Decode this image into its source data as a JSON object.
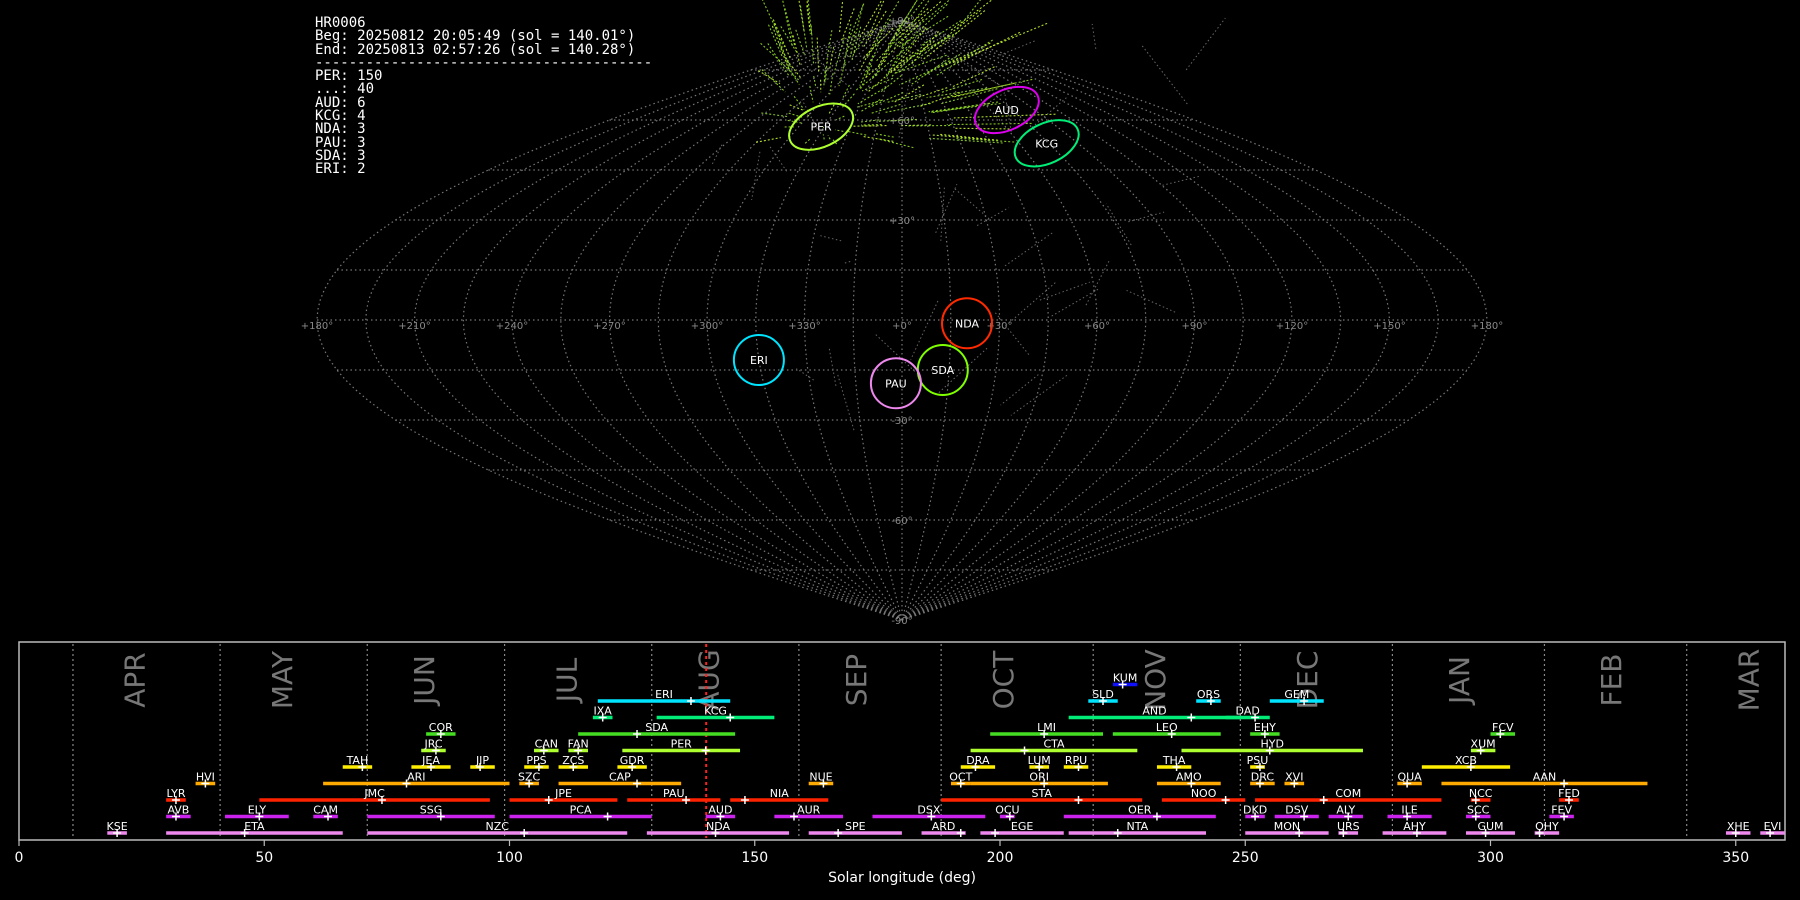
{
  "info": {
    "lines": [
      "HR0006",
      "Beg: 20250812 20:05:49 (sol = 140.01°)",
      "End: 20250813 02:57:26 (sol = 140.28°)",
      "----------------------------------------",
      "PER: 150",
      "...: 40",
      "AUD: 6",
      "KCG: 4",
      "NDA: 3",
      "PAU: 3",
      "SDA: 3",
      "ERI: 2"
    ]
  },
  "chart_data": [
    {
      "type": "scatter",
      "projection": "sinusoidal",
      "grid": true,
      "lon_tick_labels": [
        "+180°",
        "+150°",
        "+120°",
        "+90°",
        "+60°",
        "+30°",
        "+0°",
        "+330°",
        "+300°",
        "+270°",
        "+240°",
        "+210°",
        "+180°"
      ],
      "lat_tick_labels": [
        "+90°",
        "+60°",
        "+30°",
        "-30°",
        "-60°",
        "-90°"
      ],
      "radiants": [
        {
          "name": "PER",
          "lon": 47,
          "lat": 58,
          "color": "#adff2f"
        },
        {
          "name": "AUD",
          "lon": 289,
          "lat": 63,
          "color": "#dd00ee"
        },
        {
          "name": "KCG",
          "lon": 286,
          "lat": 53,
          "color": "#00ee77"
        },
        {
          "name": "NDA",
          "lon": 340,
          "lat": -1,
          "color": "#ff2a00"
        },
        {
          "name": "SDA",
          "lon": 347,
          "lat": -15,
          "color": "#7fff00"
        },
        {
          "name": "PAU",
          "lon": 2,
          "lat": -19,
          "color": "#ee88ee"
        },
        {
          "name": "ERI",
          "lon": 45,
          "lat": -12,
          "color": "#00e5ff"
        }
      ]
    },
    {
      "type": "bar",
      "orientation": "horizontal",
      "xlabel": "Solar longitude (deg)",
      "xlim": [
        0,
        360
      ],
      "x_ticks": [
        0,
        50,
        100,
        150,
        200,
        250,
        300,
        350
      ],
      "current_sol": 140.1,
      "months": [
        {
          "label": "APR",
          "pos": 24
        },
        {
          "label": "MAY",
          "pos": 54
        },
        {
          "label": "JUN",
          "pos": 83
        },
        {
          "label": "JUL",
          "pos": 112
        },
        {
          "label": "AUG",
          "pos": 141
        },
        {
          "label": "SEP",
          "pos": 171
        },
        {
          "label": "OCT",
          "pos": 201
        },
        {
          "label": "NOV",
          "pos": 232
        },
        {
          "label": "DEC",
          "pos": 263
        },
        {
          "label": "JAN",
          "pos": 294
        },
        {
          "label": "FEB",
          "pos": 325
        },
        {
          "label": "MAR",
          "pos": 353
        }
      ],
      "month_boundaries": [
        11,
        41,
        71,
        99,
        129,
        159,
        188,
        219,
        249,
        280,
        311,
        340
      ],
      "showers": [
        {
          "code": "KUM",
          "start": 223,
          "end": 228,
          "peak": 225,
          "row": 9,
          "color": "#1010ff"
        },
        {
          "code": "ERI",
          "start": 118,
          "end": 145,
          "peak": 137,
          "row": 8,
          "color": "#00e5ff"
        },
        {
          "code": "SLD",
          "start": 218,
          "end": 224,
          "peak": 221,
          "row": 8,
          "color": "#00e5ff"
        },
        {
          "code": "ORS",
          "start": 240,
          "end": 245,
          "peak": 243,
          "row": 8,
          "color": "#00e5ff"
        },
        {
          "code": "GEM",
          "start": 255,
          "end": 266,
          "peak": 262,
          "row": 8,
          "color": "#00e5ff"
        },
        {
          "code": "IXA",
          "start": 117,
          "end": 121,
          "peak": 119,
          "row": 7,
          "color": "#00ee77"
        },
        {
          "code": "KCG",
          "start": 130,
          "end": 154,
          "peak": 145,
          "row": 7,
          "color": "#00ee77"
        },
        {
          "code": "AND",
          "start": 214,
          "end": 249,
          "peak": 239,
          "row": 7,
          "color": "#00ee77"
        },
        {
          "code": "DAD",
          "start": 246,
          "end": 255,
          "peak": 252,
          "row": 7,
          "color": "#00ee77"
        },
        {
          "code": "COR",
          "start": 83,
          "end": 89,
          "peak": 86,
          "row": 6,
          "color": "#44dd22"
        },
        {
          "code": "SDA",
          "start": 114,
          "end": 146,
          "peak": 126,
          "row": 6,
          "color": "#44dd22"
        },
        {
          "code": "LMI",
          "start": 198,
          "end": 221,
          "peak": 209,
          "row": 6,
          "color": "#44dd22"
        },
        {
          "code": "LEO",
          "start": 223,
          "end": 245,
          "peak": 235,
          "row": 6,
          "color": "#44dd22"
        },
        {
          "code": "EHY",
          "start": 251,
          "end": 257,
          "peak": 254,
          "row": 6,
          "color": "#44dd22"
        },
        {
          "code": "FCV",
          "start": 300,
          "end": 305,
          "peak": 302,
          "row": 6,
          "color": "#44dd22"
        },
        {
          "code": "JRC",
          "start": 82,
          "end": 87,
          "peak": 85,
          "row": 5,
          "color": "#adff2f"
        },
        {
          "code": "CAN",
          "start": 105,
          "end": 110,
          "peak": 107,
          "row": 5,
          "color": "#adff2f"
        },
        {
          "code": "FAN",
          "start": 112,
          "end": 116,
          "peak": 114,
          "row": 5,
          "color": "#adff2f"
        },
        {
          "code": "PER",
          "start": 123,
          "end": 147,
          "peak": 140,
          "row": 5,
          "color": "#adff2f"
        },
        {
          "code": "CTA",
          "start": 194,
          "end": 228,
          "peak": 205,
          "row": 5,
          "color": "#adff2f"
        },
        {
          "code": "HYD",
          "start": 237,
          "end": 274,
          "peak": 255,
          "row": 5,
          "color": "#adff2f"
        },
        {
          "code": "XUM",
          "start": 296,
          "end": 301,
          "peak": 298,
          "row": 5,
          "color": "#adff2f"
        },
        {
          "code": "TAH",
          "start": 66,
          "end": 72,
          "peak": 70,
          "row": 4,
          "color": "#ffee00"
        },
        {
          "code": "JEA",
          "start": 80,
          "end": 88,
          "peak": 84,
          "row": 4,
          "color": "#ffee00"
        },
        {
          "code": "JIP",
          "start": 92,
          "end": 97,
          "peak": 94,
          "row": 4,
          "color": "#ffee00"
        },
        {
          "code": "PPS",
          "start": 103,
          "end": 108,
          "peak": 106,
          "row": 4,
          "color": "#ffee00"
        },
        {
          "code": "ZCS",
          "start": 110,
          "end": 116,
          "peak": 113,
          "row": 4,
          "color": "#ffee00"
        },
        {
          "code": "GDR",
          "start": 122,
          "end": 128,
          "peak": 125,
          "row": 4,
          "color": "#ffee00"
        },
        {
          "code": "DRA",
          "start": 192,
          "end": 199,
          "peak": 195,
          "row": 4,
          "color": "#ffee00"
        },
        {
          "code": "LUM",
          "start": 206,
          "end": 210,
          "peak": 208,
          "row": 4,
          "color": "#ffee00"
        },
        {
          "code": "RPU",
          "start": 213,
          "end": 218,
          "peak": 216,
          "row": 4,
          "color": "#ffee00"
        },
        {
          "code": "THA",
          "start": 232,
          "end": 239,
          "peak": 236,
          "row": 4,
          "color": "#ffee00"
        },
        {
          "code": "PSU",
          "start": 251,
          "end": 254,
          "peak": 253,
          "row": 4,
          "color": "#ffee00"
        },
        {
          "code": "XCB",
          "start": 286,
          "end": 304,
          "peak": 296,
          "row": 4,
          "color": "#ffee00"
        },
        {
          "code": "HVI",
          "start": 36,
          "end": 40,
          "peak": 38,
          "row": 3,
          "color": "#ffaa00"
        },
        {
          "code": "ARI",
          "start": 62,
          "end": 100,
          "peak": 79,
          "row": 3,
          "color": "#ffaa00"
        },
        {
          "code": "SZC",
          "start": 102,
          "end": 106,
          "peak": 104,
          "row": 3,
          "color": "#ffaa00"
        },
        {
          "code": "CAP",
          "start": 110,
          "end": 135,
          "peak": 126,
          "row": 3,
          "color": "#ffaa00"
        },
        {
          "code": "NUE",
          "start": 161,
          "end": 166,
          "peak": 164,
          "row": 3,
          "color": "#ffaa00"
        },
        {
          "code": "OCT",
          "start": 190,
          "end": 194,
          "peak": 192,
          "row": 3,
          "color": "#ffaa00"
        },
        {
          "code": "ORI",
          "start": 194,
          "end": 222,
          "peak": 209,
          "row": 3,
          "color": "#ffaa00"
        },
        {
          "code": "AMO",
          "start": 232,
          "end": 245,
          "peak": 239,
          "row": 3,
          "color": "#ffaa00"
        },
        {
          "code": "DRC",
          "start": 251,
          "end": 256,
          "peak": 253,
          "row": 3,
          "color": "#ffaa00"
        },
        {
          "code": "XVI",
          "start": 258,
          "end": 262,
          "peak": 260,
          "row": 3,
          "color": "#ffaa00"
        },
        {
          "code": "QUA",
          "start": 281,
          "end": 286,
          "peak": 283,
          "row": 3,
          "color": "#ffaa00"
        },
        {
          "code": "AAN",
          "start": 290,
          "end": 332,
          "peak": 315,
          "row": 3,
          "color": "#ffaa00"
        },
        {
          "code": "LYR",
          "start": 30,
          "end": 34,
          "peak": 32,
          "row": 2,
          "color": "#ff2200"
        },
        {
          "code": "JMC",
          "start": 49,
          "end": 96,
          "peak": 74,
          "row": 2,
          "color": "#ff2200"
        },
        {
          "code": "JPE",
          "start": 100,
          "end": 122,
          "peak": 108,
          "row": 2,
          "color": "#ff2200"
        },
        {
          "code": "PAU",
          "start": 124,
          "end": 143,
          "peak": 136,
          "row": 2,
          "color": "#ff2200"
        },
        {
          "code": "NIA",
          "start": 145,
          "end": 165,
          "peak": 148,
          "row": 2,
          "color": "#ff2200"
        },
        {
          "code": "STA",
          "start": 188,
          "end": 229,
          "peak": 216,
          "row": 2,
          "color": "#ff2200"
        },
        {
          "code": "NOO",
          "start": 233,
          "end": 250,
          "peak": 246,
          "row": 2,
          "color": "#ff2200"
        },
        {
          "code": "COM",
          "start": 252,
          "end": 290,
          "peak": 266,
          "row": 2,
          "color": "#ff2200"
        },
        {
          "code": "NCC",
          "start": 296,
          "end": 300,
          "peak": 297,
          "row": 2,
          "color": "#ff2200"
        },
        {
          "code": "FED",
          "start": 314,
          "end": 318,
          "peak": 316,
          "row": 2,
          "color": "#ff2200"
        },
        {
          "code": "AVB",
          "start": 30,
          "end": 35,
          "peak": 32,
          "row": 1,
          "color": "#cc22ee"
        },
        {
          "code": "ELY",
          "start": 42,
          "end": 55,
          "peak": 49,
          "row": 1,
          "color": "#cc22ee"
        },
        {
          "code": "CAM",
          "start": 60,
          "end": 65,
          "peak": 63,
          "row": 1,
          "color": "#cc22ee"
        },
        {
          "code": "SSG",
          "start": 71,
          "end": 97,
          "peak": 86,
          "row": 1,
          "color": "#cc22ee"
        },
        {
          "code": "PCA",
          "start": 100,
          "end": 129,
          "peak": 120,
          "row": 1,
          "color": "#cc22ee"
        },
        {
          "code": "AUD",
          "start": 140,
          "end": 146,
          "peak": 143,
          "row": 1,
          "color": "#cc22ee"
        },
        {
          "code": "AUR",
          "start": 154,
          "end": 168,
          "peak": 158,
          "row": 1,
          "color": "#cc22ee"
        },
        {
          "code": "DSX",
          "start": 174,
          "end": 197,
          "peak": 186,
          "row": 1,
          "color": "#cc22ee"
        },
        {
          "code": "OCU",
          "start": 200,
          "end": 203,
          "peak": 202,
          "row": 1,
          "color": "#cc22ee"
        },
        {
          "code": "OER",
          "start": 213,
          "end": 244,
          "peak": 232,
          "row": 1,
          "color": "#cc22ee"
        },
        {
          "code": "DKD",
          "start": 250,
          "end": 254,
          "peak": 252,
          "row": 1,
          "color": "#cc22ee"
        },
        {
          "code": "DSV",
          "start": 256,
          "end": 265,
          "peak": 262,
          "row": 1,
          "color": "#cc22ee"
        },
        {
          "code": "ALY",
          "start": 267,
          "end": 274,
          "peak": 271,
          "row": 1,
          "color": "#cc22ee"
        },
        {
          "code": "ILE",
          "start": 279,
          "end": 288,
          "peak": 283,
          "row": 1,
          "color": "#cc22ee"
        },
        {
          "code": "SCC",
          "start": 295,
          "end": 300,
          "peak": 297,
          "row": 1,
          "color": "#cc22ee"
        },
        {
          "code": "FEV",
          "start": 312,
          "end": 317,
          "peak": 315,
          "row": 1,
          "color": "#cc22ee"
        },
        {
          "code": "KSE",
          "start": 18,
          "end": 22,
          "peak": 20,
          "row": 0,
          "color": "#ee88ee"
        },
        {
          "code": "ETA",
          "start": 30,
          "end": 66,
          "peak": 46,
          "row": 0,
          "color": "#ee88ee"
        },
        {
          "code": "NZC",
          "start": 71,
          "end": 124,
          "peak": 103,
          "row": 0,
          "color": "#ee88ee"
        },
        {
          "code": "NDA",
          "start": 128,
          "end": 157,
          "peak": 142,
          "row": 0,
          "color": "#ee88ee"
        },
        {
          "code": "SPE",
          "start": 161,
          "end": 180,
          "peak": 167,
          "row": 0,
          "color": "#ee88ee"
        },
        {
          "code": "ARD",
          "start": 184,
          "end": 193,
          "peak": 192,
          "row": 0,
          "color": "#ee88ee"
        },
        {
          "code": "EGE",
          "start": 196,
          "end": 213,
          "peak": 199,
          "row": 0,
          "color": "#ee88ee"
        },
        {
          "code": "NTA",
          "start": 214,
          "end": 242,
          "peak": 224,
          "row": 0,
          "color": "#ee88ee"
        },
        {
          "code": "MON",
          "start": 250,
          "end": 267,
          "peak": 261,
          "row": 0,
          "color": "#ee88ee"
        },
        {
          "code": "URS",
          "start": 269,
          "end": 273,
          "peak": 270,
          "row": 0,
          "color": "#ee88ee"
        },
        {
          "code": "AHY",
          "start": 278,
          "end": 291,
          "peak": 285,
          "row": 0,
          "color": "#ee88ee"
        },
        {
          "code": "GUM",
          "start": 295,
          "end": 305,
          "peak": 299,
          "row": 0,
          "color": "#ee88ee"
        },
        {
          "code": "OHY",
          "start": 309,
          "end": 314,
          "peak": 310,
          "row": 0,
          "color": "#ee88ee"
        },
        {
          "code": "XHE",
          "start": 348,
          "end": 353,
          "peak": 350,
          "row": 0,
          "color": "#ee88ee"
        },
        {
          "code": "EVI",
          "start": 355,
          "end": 360,
          "peak": 357,
          "row": 0,
          "color": "#ee88ee"
        }
      ]
    }
  ]
}
